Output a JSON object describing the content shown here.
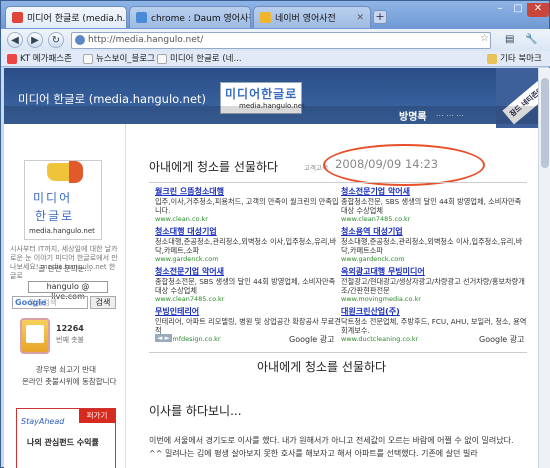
{
  "browser": {
    "tabs": [
      {
        "label": "미디어 한글로 (media.h...",
        "active": true
      },
      {
        "label": "chrome : Daum 영어사전",
        "active": false
      },
      {
        "label": "네이버 영어사전",
        "active": false
      }
    ],
    "new_tab": "+",
    "window_controls": {
      "minimize": "–",
      "maximize": "□",
      "close": "✕"
    },
    "url": "http://media.hangulo.net/",
    "nav": {
      "back": "◀",
      "forward": "▶",
      "reload": "↻",
      "page_menu": "▤",
      "wrench": "🔧"
    },
    "bookmarks": [
      "KT 메가패스존",
      "뉴스보이_블로그",
      "미디어 한글로 (네..."
    ],
    "other_bookmarks": "기타 북마크"
  },
  "site": {
    "title": "미디어 한글로 (media.hangulo.net)",
    "logo_main": "미디어한글로",
    "logo_sub": "media.hangulo.net",
    "banner": "잠드 네티즌이 후원해요!",
    "nav_main": "방명록",
    "nav_others": "... ... ..."
  },
  "sidebar": {
    "logo_line1": "미디어",
    "logo_line2": "한글로",
    "logo_url": "media.hangulo.net",
    "desc": "시사부터 IT까지, 세상일에 대한 날카로운 눈 이야기 미디어 한글로에서 만나보세요! media.hangulo.net 한글로",
    "contact": "글 관련 문의는...",
    "email": "hangulo @ live.com",
    "search_placeholder": "맞춤검색",
    "search_brand": "Google",
    "search_button": "검색",
    "count": "12264",
    "count_label": "번째 촛불",
    "msg1": "광우병 쇠고기 반대",
    "msg2": "온라인 촛불시위에 동참합니다",
    "stayahead": "StayAhead",
    "stayahead_tag": "퍼가기",
    "stayahead_item": "나의 관심펀드 수익률"
  },
  "post": {
    "title": "아내에게 청소를 선물하다",
    "author": "고객고객",
    "date": "2008/09/09 14:23",
    "ads_left": [
      {
        "title": "월크린 으뜸청소대행",
        "desc": "입주,이사,거주청소,피용처드, 고객의 만족이 월크린의 만족입니다.",
        "url": "www.clean.co.kr"
      },
      {
        "title": "청소대행 대성기업",
        "desc": "청소대행,준공청소,관리청소,외벽청소 이사,입주청소,유리,바닥,카페트,소파",
        "url": "www.gardenck.com"
      },
      {
        "title": "청소전문기업 악어새",
        "desc": "종합청소전문, SBS 생생의 달인 44회 방영업체, 소비자만족대상 수상업체",
        "url": "www.clean7485.co.kr"
      },
      {
        "title": "무빙인테리어",
        "desc": "인테리어, 아파트 리모델링, 병원 및 상업공간 확장공사 무료견적",
        "url": "www.mfdesign.co.kr"
      }
    ],
    "ads_right": [
      {
        "title": "청소전문기업 악어새",
        "desc": "종합청소전문, SBS 생생의 달인 44회 방영업체, 소비자만족대상 수상업체",
        "url": "www.clean7485.co.kr"
      },
      {
        "title": "청소용역 대성기업",
        "desc": "청소대행,준공청소,관리청소,외벽청소 이사,입주청소,유리,바닥,카페트소파",
        "url": "www.gardenck.com"
      },
      {
        "title": "옥외광고대행 무빙미디어",
        "desc": "전철광고/현대광고/생상자광고/차량광고 선거차량/홍보차량개조/간판현판전문",
        "url": "www.movingmedia.co.kr"
      },
      {
        "title": "대원크린산업(주)",
        "desc": "닥트청소 전문업체, 주방후드, FCU, AHU, 보일러, 청소, 용역회계보수.",
        "url": "www.ductcleaning.co.kr"
      }
    ],
    "ad_label": "Google 광고",
    "ad_arrows": "◄ ►",
    "body_title": "아내에게 청소를 선물하다",
    "body_heading": "이사를 하다보니...",
    "body_text": "이번에 서울에서 경기도로 이사를 했다. 내가 원해서가 아니고 전세값이 오르는 바람에 어쩔 수 없이 밀려났다. ^^ 밀려나는 김에 평생 살아보지 못한 호사를 해보자고 해서 아파트를 선택했다. 기존에 살던 빌라"
  },
  "colors": {
    "header_bg": "#2a4d86",
    "circle": "#e8502a",
    "ad_title": "#1a2fbd",
    "ad_url": "#2a8a2a"
  }
}
